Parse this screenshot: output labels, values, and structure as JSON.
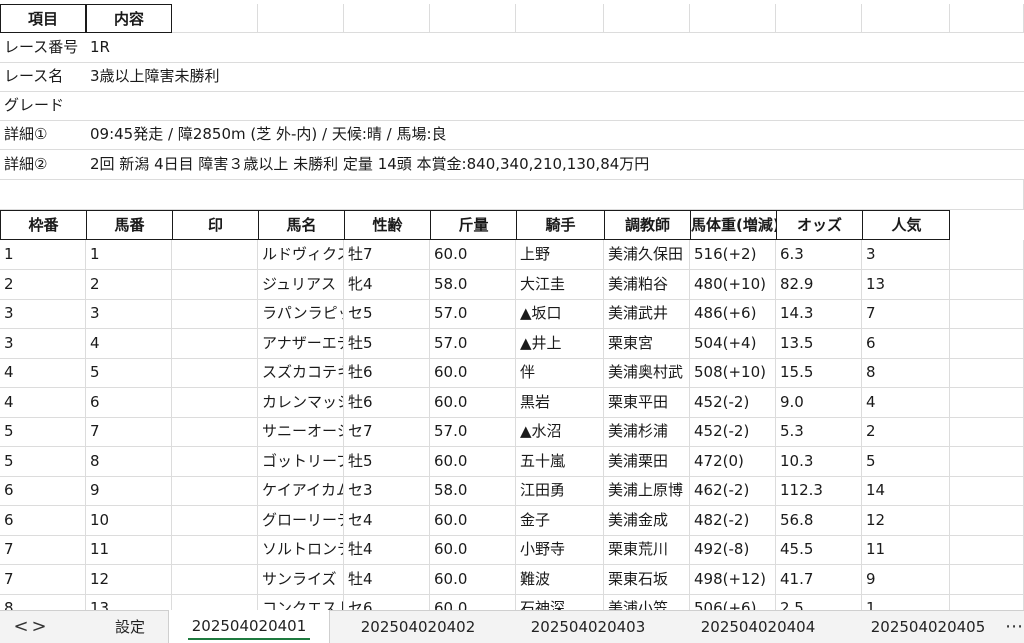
{
  "info": {
    "header": [
      "項目",
      "内容"
    ],
    "rows": [
      [
        "レース番号",
        "1R"
      ],
      [
        "レース名",
        "3歳以上障害未勝利"
      ],
      [
        "グレード",
        ""
      ],
      [
        "詳細①",
        "09:45発走 / 障2850m (芝 外-内) / 天候:晴 / 馬場:良"
      ],
      [
        "詳細②",
        "2回 新潟 4日目 障害３歳以上 未勝利 定量 14頭 本賞金:840,340,210,130,84万円"
      ]
    ]
  },
  "entries": {
    "columns": [
      "枠番",
      "馬番",
      "印",
      "馬名",
      "性齢",
      "斤量",
      "騎手",
      "調教師",
      "馬体重(増減)",
      "オッズ",
      "人気"
    ],
    "rows": [
      [
        "1",
        "1",
        "",
        "ルドヴィクス",
        "牡7",
        "60.0",
        "上野",
        "美浦久保田",
        "516(+2)",
        "6.3",
        "3"
      ],
      [
        "2",
        "2",
        "",
        "ジュリアス",
        "牝4",
        "58.0",
        "大江圭",
        "美浦粕谷",
        "480(+10)",
        "82.9",
        "13"
      ],
      [
        "3",
        "3",
        "",
        "ラパンラピッド",
        "セ5",
        "57.0",
        "▲坂口",
        "美浦武井",
        "486(+6)",
        "14.3",
        "7"
      ],
      [
        "3",
        "4",
        "",
        "アナザーエデン",
        "牡5",
        "57.0",
        "▲井上",
        "栗東宮",
        "504(+4)",
        "13.5",
        "6"
      ],
      [
        "4",
        "5",
        "",
        "スズカコテキタイ",
        "牡6",
        "60.0",
        "伴",
        "美浦奥村武",
        "508(+10)",
        "15.5",
        "8"
      ],
      [
        "4",
        "6",
        "",
        "カレンマッシヴ",
        "牡6",
        "60.0",
        "黒岩",
        "栗東平田",
        "452(-2)",
        "9.0",
        "4"
      ],
      [
        "5",
        "7",
        "",
        "サニーオーシャン",
        "セ7",
        "57.0",
        "▲水沼",
        "美浦杉浦",
        "452(-2)",
        "5.3",
        "2"
      ],
      [
        "5",
        "8",
        "",
        "ゴットリープ",
        "牡5",
        "60.0",
        "五十嵐",
        "美浦栗田",
        "472(0)",
        "10.3",
        "5"
      ],
      [
        "6",
        "9",
        "",
        "ケイアイカムイ",
        "セ3",
        "58.0",
        "江田勇",
        "美浦上原博",
        "462(-2)",
        "112.3",
        "14"
      ],
      [
        "6",
        "10",
        "",
        "グローリーデイ",
        "セ4",
        "60.0",
        "金子",
        "美浦金成",
        "482(-2)",
        "56.8",
        "12"
      ],
      [
        "7",
        "11",
        "",
        "ソルトロンテ",
        "牡4",
        "60.0",
        "小野寺",
        "栗東荒川",
        "492(-8)",
        "45.5",
        "11"
      ],
      [
        "7",
        "12",
        "",
        "サンライズ",
        "牡4",
        "60.0",
        "難波",
        "栗東石坂",
        "498(+12)",
        "41.7",
        "9"
      ],
      [
        "8",
        "13",
        "",
        "コンクエスト",
        "セ6",
        "60.0",
        "石神深",
        "美浦小笠",
        "506(+6)",
        "2.5",
        "1"
      ]
    ]
  },
  "tabs": {
    "nav_prev": "<",
    "nav_next": ">",
    "items": [
      "設定",
      "202504020401",
      "202504020402",
      "202504020403",
      "202504020404",
      "202504020405"
    ],
    "active_index": 1,
    "more": "⋯"
  }
}
